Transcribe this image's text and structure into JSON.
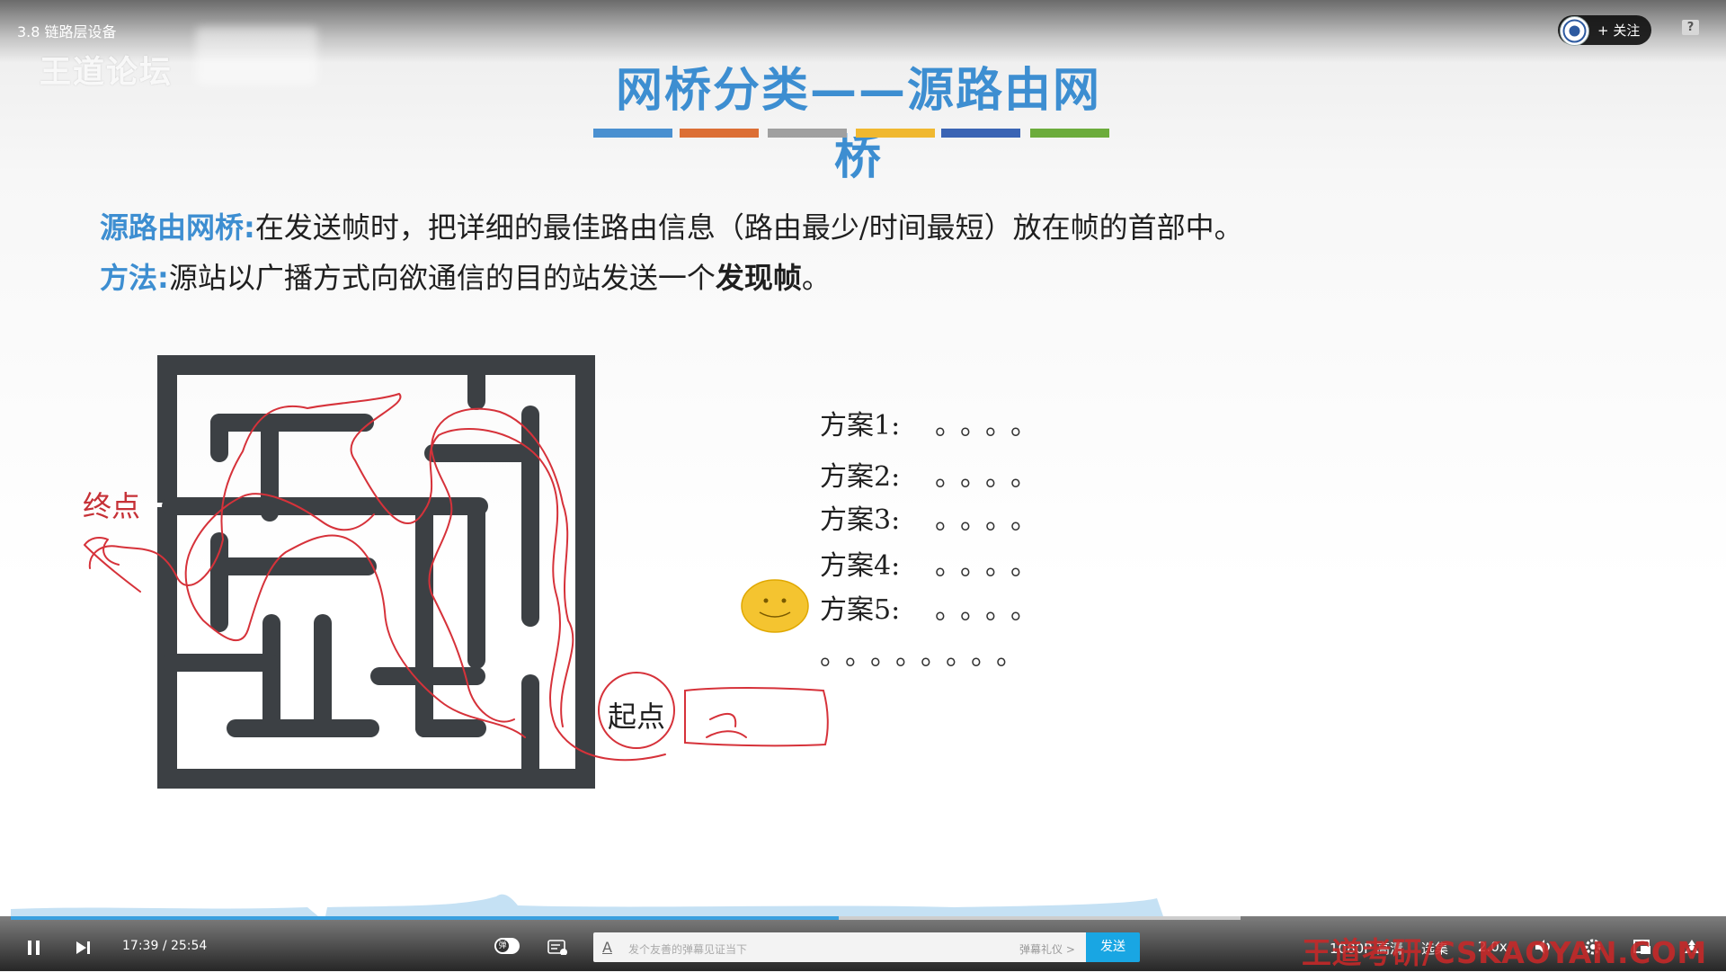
{
  "player": {
    "video_title": "3.8 链路层设备",
    "watermark_top": "王道论坛",
    "follow_label": "+ 关注",
    "help_glyph": "?",
    "time_current": "17:39",
    "time_sep": "/",
    "time_total": "25:54",
    "progress_fraction": 0.673,
    "danmu_toggle_glyph": "弹",
    "danmu_placeholder": "发个友善的弹幕见证当下",
    "danmu_etiquette": "弹幕礼仪 >",
    "danmu_a_glyph": "A",
    "send_label": "发送",
    "quality_label": "1080P 高清",
    "episodes_label": "选集",
    "speed_label": "2.0x",
    "watermark_bottom": "王道考研/CSKAOYAN.COM",
    "accent": "#19a6e3"
  },
  "slide": {
    "title": "网桥分类——源路由网桥",
    "title_color": "#3d8ed1",
    "strip_colors": [
      "#4a90d0",
      "#dc6f35",
      "#a0a0a0",
      "#f0b830",
      "#3a64b4",
      "#6cac3c"
    ],
    "definition_term": "源路由网桥:",
    "definition_text": "在发送帧时，把详细的最佳路由信息（路由最少/时间最短）放在帧的首部中。",
    "method_term": "方法:",
    "method_text_a": "源站以广播方式向欲通信的目的站发送一个",
    "method_text_bold": "发现帧",
    "method_text_end": "。",
    "maze_label_end": "终点",
    "maze_label_start": "起点",
    "plans": [
      {
        "label": "方案1:",
        "dots": "。。。。"
      },
      {
        "label": "方案2:",
        "dots": "。。。。"
      },
      {
        "label": "方案3:",
        "dots": "。。。。"
      },
      {
        "label": "方案4:",
        "dots": "。。。。"
      },
      {
        "label": "方案5:",
        "dots": "。。。。"
      }
    ],
    "trailing_dots": "。。。。。。。。",
    "handwriting_start_note": "发",
    "ink_color": "#d6323a"
  }
}
